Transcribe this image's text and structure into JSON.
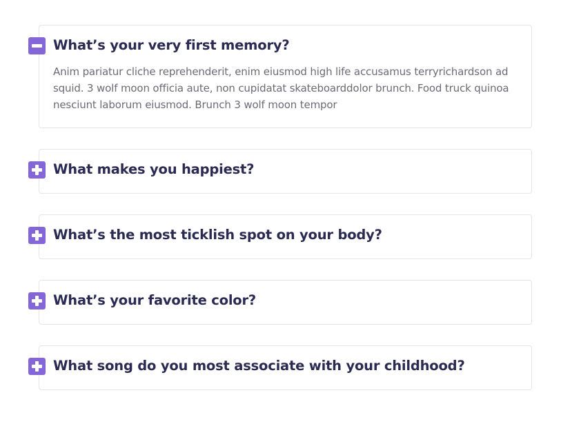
{
  "faq": {
    "items": [
      {
        "question": "What’s your very first memory?",
        "answer": "Anim pariatur cliche reprehenderit, enim eiusmod high life accusamus terryrichardson ad squid. 3 wolf moon officia aute, non cupidatat skateboarddolor brunch. Food truck quinoa nesciunt laborum eiusmod. Brunch 3 wolf moon tempor",
        "expanded": true,
        "toggle_icon": "minus-icon"
      },
      {
        "question": "What makes you happiest?",
        "expanded": false,
        "toggle_icon": "plus-icon"
      },
      {
        "question": "What’s the most ticklish spot on your body?",
        "expanded": false,
        "toggle_icon": "plus-icon"
      },
      {
        "question": "What’s your favorite color?",
        "expanded": false,
        "toggle_icon": "plus-icon"
      },
      {
        "question": "What song do you most associate with your childhood?",
        "expanded": false,
        "toggle_icon": "plus-icon"
      }
    ]
  },
  "colors": {
    "accent": "#8466d8",
    "heading": "#2b2a52",
    "body_text": "#6b6b76",
    "border": "#e4e4ea"
  }
}
